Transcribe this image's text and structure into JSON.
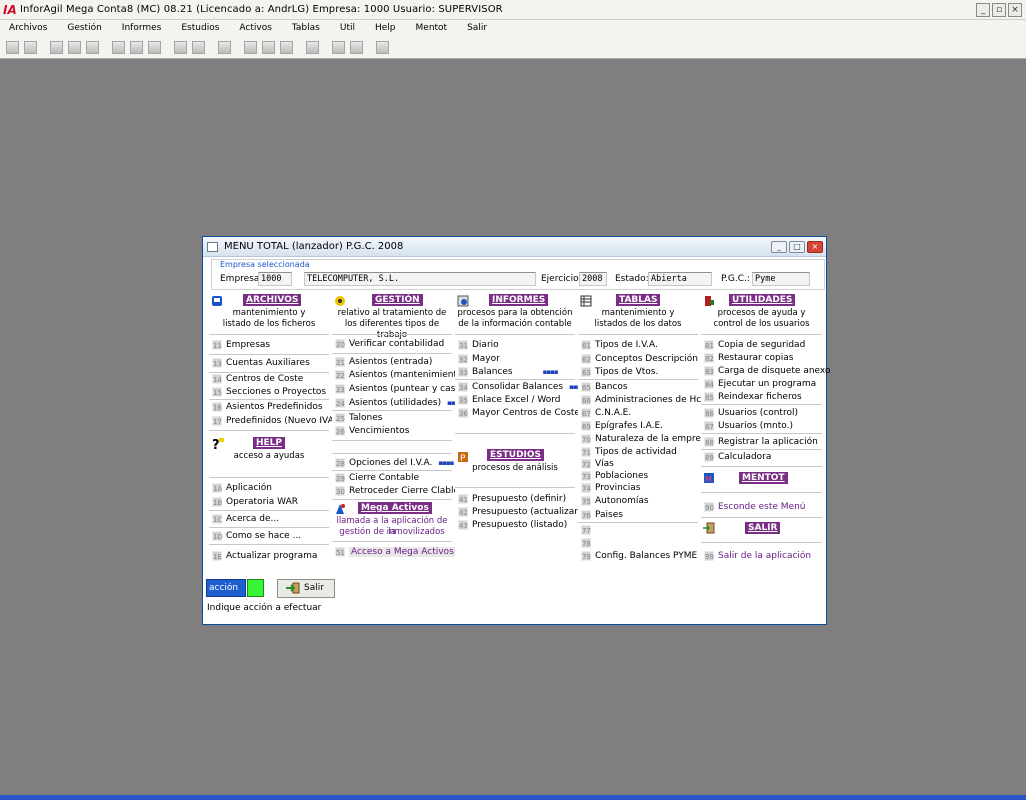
{
  "app": {
    "logo": "IA",
    "title": "InforAgil Mega Conta8 (MC) 08.21  (Licencado a: AndrLG)  Empresa: 1000  Usuario: SUPERVISOR"
  },
  "menubar": [
    "Archivos",
    "Gestión",
    "Informes",
    "Estudios",
    "Activos",
    "Tablas",
    "Util",
    "Help",
    "Mentot",
    "Salir"
  ],
  "dialog": {
    "title": "MENU TOTAL (lanzador) P.G.C. 2008",
    "empresa_group": "Empresa seleccionada",
    "empresa_label": "Empresa:",
    "empresa_code": "1000",
    "empresa_name": "TELECOMPUTER, S.L.",
    "ejercicio_label": "Ejercicio:",
    "ejercicio_value": "2008",
    "estado_label": "Estado:",
    "estado_value": "Abierta",
    "pgc_label": "P.G.C.:",
    "pgc_value": "Pyme"
  },
  "archivos": {
    "title": "ARCHIVOS",
    "sub1": "mantenimiento y",
    "sub2": "listado de los ficheros",
    "items": [
      {
        "n": "11",
        "label": "Empresas"
      },
      {
        "n": "13",
        "label": "Cuentas Auxiliares"
      },
      {
        "n": "14",
        "label": "Centros de Coste"
      },
      {
        "n": "15",
        "label": "Secciones o Proyectos"
      },
      {
        "n": "16",
        "label": "Asientos Predefinidos"
      },
      {
        "n": "17",
        "label": "Predefinidos (Nuevo IVA)"
      }
    ]
  },
  "help": {
    "title": "HELP",
    "sub": "acceso a ayudas",
    "items": [
      {
        "n": "1A",
        "label": "Aplicación"
      },
      {
        "n": "1B",
        "label": "Operatoria WAR"
      },
      {
        "n": "1C",
        "label": "Acerca de..."
      },
      {
        "n": "1D",
        "label": "Como se hace ..."
      },
      {
        "n": "1E",
        "label": "Actualizar programa"
      }
    ]
  },
  "gestion": {
    "title": "GESTIÓN",
    "sub1": "relativo al tratamiento de",
    "sub2": "los diferentes tipos de trabajo",
    "items": [
      {
        "n": "20",
        "label": "Verificar contabilidad"
      },
      {
        "n": "21",
        "label": "Asientos (entrada)"
      },
      {
        "n": "22",
        "label": "Asientos (mantenimiento)"
      },
      {
        "n": "23",
        "label": "Asientos (puntear y casar)"
      },
      {
        "n": "24",
        "label": "Asientos (utilidades)"
      },
      {
        "n": "25",
        "label": "Talones"
      },
      {
        "n": "26",
        "label": "Vencimientos"
      },
      {
        "n": "28",
        "label": "Opciones del I.V.A."
      },
      {
        "n": "29",
        "label": "Cierre Contable"
      },
      {
        "n": "30",
        "label": "Retroceder Cierre Clable."
      }
    ],
    "more": "▪▪▪▪"
  },
  "mega": {
    "title": "Mega Activos",
    "sub1": "llamada a la aplicación de la",
    "sub2": "gestión de inmovilizados",
    "item": {
      "n": "51",
      "label": "Acceso a Mega Activos"
    }
  },
  "informes": {
    "title": "INFORMES",
    "sub1": "procesos para la obtención",
    "sub2": "de la información contable",
    "items": [
      {
        "n": "31",
        "label": "Diario"
      },
      {
        "n": "32",
        "label": "Mayor"
      },
      {
        "n": "33",
        "label": "Balances"
      },
      {
        "n": "34",
        "label": "Consolidar Balances"
      },
      {
        "n": "35",
        "label": "Enlace Excel / Word"
      },
      {
        "n": "36",
        "label": "Mayor Centros de Coste"
      }
    ]
  },
  "estudios": {
    "title": "ESTUDIOS",
    "sub": "procesos de análisis",
    "items": [
      {
        "n": "41",
        "label": "Presupuesto (definir)"
      },
      {
        "n": "42",
        "label": "Presupuesto (actualizar)"
      },
      {
        "n": "43",
        "label": "Presupuesto (listado)"
      }
    ]
  },
  "tablas": {
    "title": "TABLAS",
    "sub1": "mantenimiento y",
    "sub2": "listados de los datos",
    "items": [
      {
        "n": "61",
        "label": "Tipos de I.V.A."
      },
      {
        "n": "62",
        "label": "Conceptos Descripción"
      },
      {
        "n": "63",
        "label": "Tipos de Vtos."
      },
      {
        "n": "65",
        "label": "Bancos"
      },
      {
        "n": "66",
        "label": "Administraciones de Hcda."
      },
      {
        "n": "67",
        "label": "C.N.A.E."
      },
      {
        "n": "69",
        "label": "Epígrafes I.A.E."
      },
      {
        "n": "70",
        "label": "Naturaleza de la empresa"
      },
      {
        "n": "71",
        "label": "Tipos de actividad"
      },
      {
        "n": "72",
        "label": "Vías"
      },
      {
        "n": "73",
        "label": "Poblaciones"
      },
      {
        "n": "74",
        "label": "Provincias"
      },
      {
        "n": "75",
        "label": "Autonomías"
      },
      {
        "n": "76",
        "label": "Paises"
      },
      {
        "n": "77",
        "label": ""
      },
      {
        "n": "78",
        "label": ""
      },
      {
        "n": "79",
        "label": "Config. Balances PYME"
      }
    ]
  },
  "utilidades": {
    "title": "UTILIDADES",
    "sub1": "procesos de ayuda y",
    "sub2": "control de los usuarios",
    "items": [
      {
        "n": "81",
        "label": "Copia de seguridad"
      },
      {
        "n": "82",
        "label": "Restaurar copias"
      },
      {
        "n": "83",
        "label": "Carga de disquete anexo"
      },
      {
        "n": "84",
        "label": "Ejecutar un programa"
      },
      {
        "n": "85",
        "label": "Reindexar ficheros"
      },
      {
        "n": "86",
        "label": "Usuarios (control)"
      },
      {
        "n": "87",
        "label": "Usuarios (mnto.)"
      },
      {
        "n": "88",
        "label": "Registrar la aplicación"
      },
      {
        "n": "89",
        "label": "Calculadora"
      }
    ]
  },
  "mentot": {
    "title": "MENTOT",
    "item": {
      "n": "90",
      "label": "Esconde este Menú"
    }
  },
  "salir": {
    "title": "SALIR",
    "item": {
      "n": "99",
      "label": "Salir de la aplicación"
    }
  },
  "bottom": {
    "accion_label": "acción",
    "salir_label": "Salir",
    "status": "Indique acción a efectuar"
  }
}
